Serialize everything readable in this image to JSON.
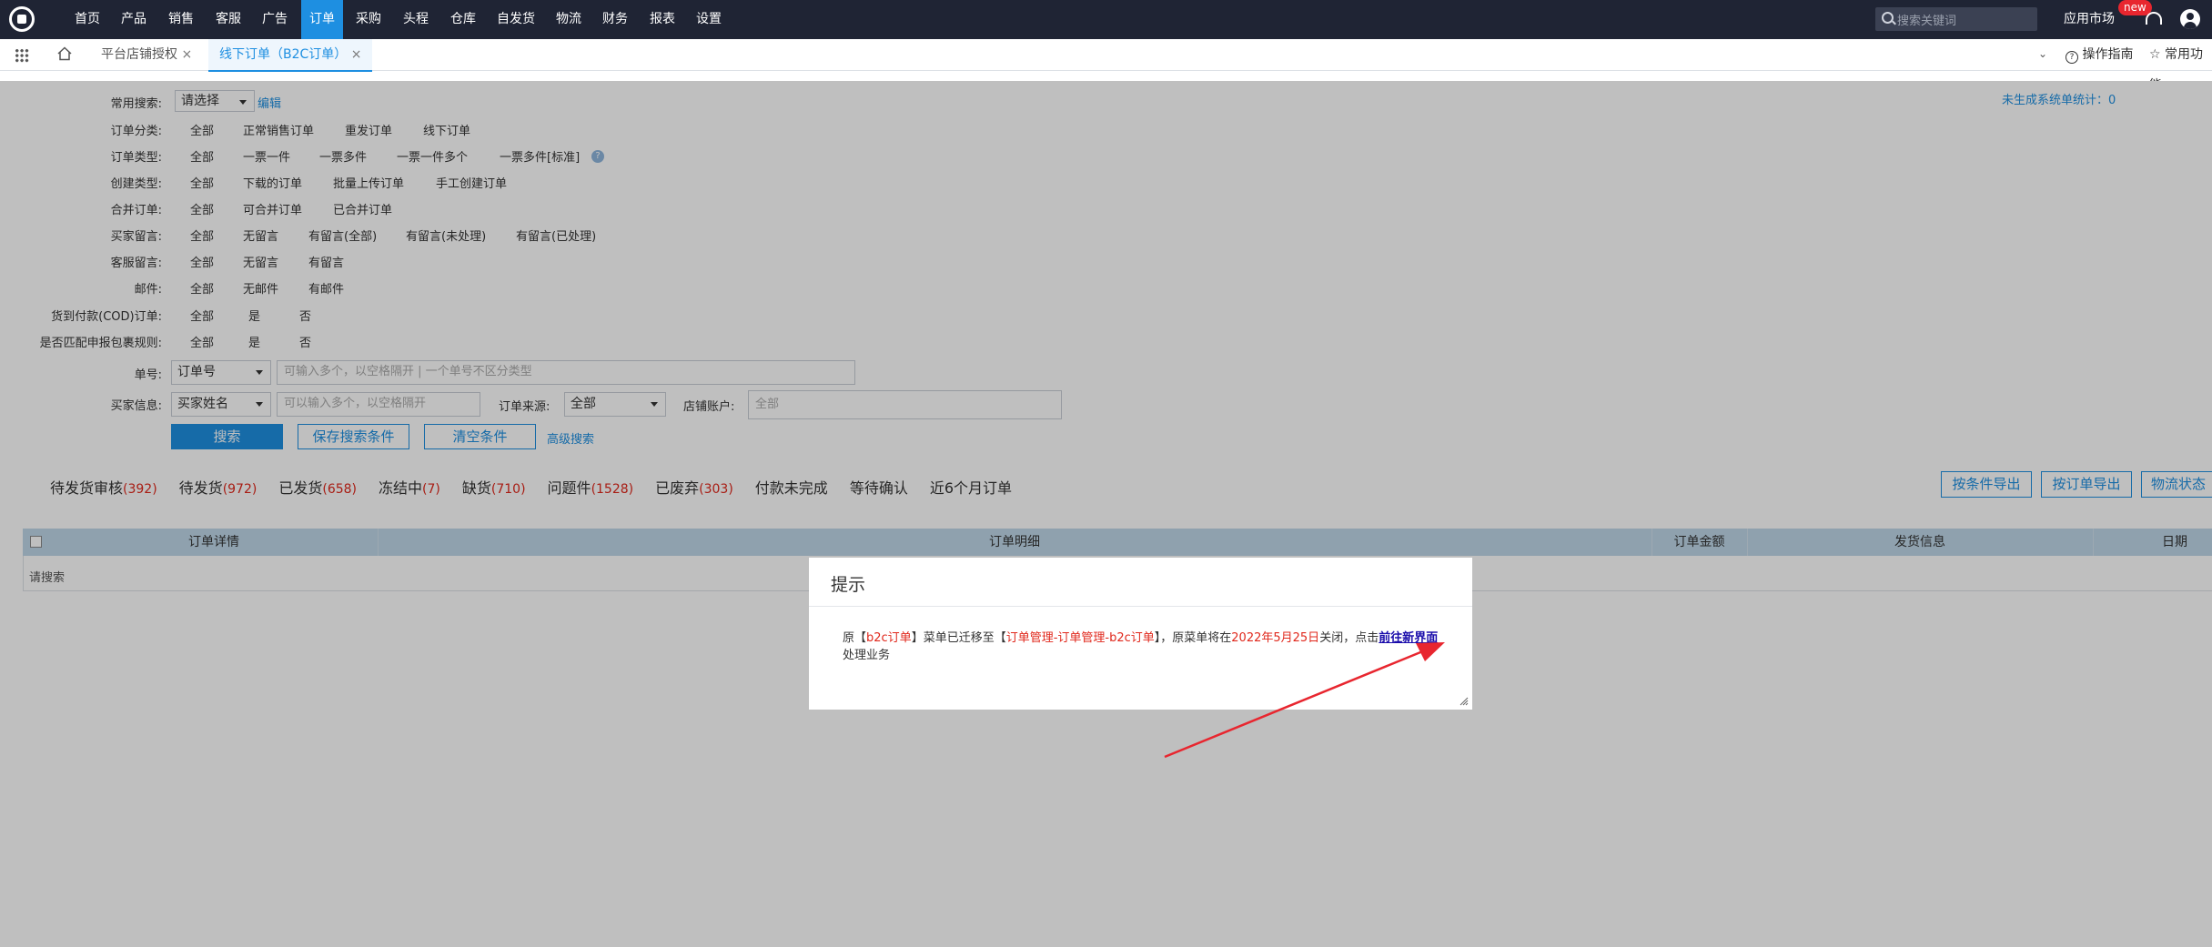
{
  "nav": {
    "items": [
      "首页",
      "产品",
      "销售",
      "客服",
      "广告",
      "订单",
      "采购",
      "头程",
      "仓库",
      "自发货",
      "物流",
      "财务",
      "报表",
      "设置"
    ],
    "active": "订单",
    "search_placeholder": "搜索关键词",
    "app_market": "应用市场",
    "new_badge": "new"
  },
  "tabs": {
    "items": [
      {
        "label": "平台店铺授权",
        "close": "×"
      },
      {
        "label": "线下订单（B2C订单）",
        "close": "×"
      }
    ],
    "guide": "操作指南",
    "common": "常用功能"
  },
  "filters": {
    "stats_link": "未生成系统单统计：0",
    "common_search_label": "常用搜索:",
    "common_search_value": "请选择",
    "edit": "编辑",
    "rows": [
      {
        "label": "订单分类:",
        "options": [
          "全部",
          "正常销售订单",
          "重发订单",
          "线下订单"
        ]
      },
      {
        "label": "订单类型:",
        "options": [
          "全部",
          "一票一件",
          "一票多件",
          "一票一件多个",
          "一票多件[标准]"
        ]
      },
      {
        "label": "创建类型:",
        "options": [
          "全部",
          "下载的订单",
          "批量上传订单",
          "手工创建订单"
        ]
      },
      {
        "label": "合并订单:",
        "options": [
          "全部",
          "可合并订单",
          "已合并订单"
        ]
      },
      {
        "label": "买家留言:",
        "options": [
          "全部",
          "无留言",
          "有留言(全部)",
          "有留言(未处理)",
          "有留言(已处理)"
        ]
      },
      {
        "label": "客服留言:",
        "options": [
          "全部",
          "无留言",
          "有留言"
        ]
      },
      {
        "label": "邮件:",
        "options": [
          "全部",
          "无邮件",
          "有邮件"
        ]
      },
      {
        "label": "货到付款(COD)订单:",
        "options": [
          "全部",
          "是",
          "否"
        ]
      },
      {
        "label": "是否匹配申报包裹规则:",
        "options": [
          "全部",
          "是",
          "否"
        ]
      }
    ],
    "help_glyph": "?",
    "order_no_label": "单号:",
    "order_no_type": "订单号",
    "order_no_placeholder": "可输入多个，以空格隔开 | 一个单号不区分类型",
    "buyer_label": "买家信息:",
    "buyer_type": "买家姓名",
    "buyer_placeholder": "可以输入多个，以空格隔开",
    "source_label": "订单来源:",
    "source_value": "全部",
    "account_label": "店铺账户:",
    "account_placeholder": "全部",
    "search_btn": "搜索",
    "save_btn": "保存搜索条件",
    "clear_btn": "清空条件",
    "advanced": "高级搜索"
  },
  "status_tabs": [
    {
      "label": "待发货审核",
      "count": "(392)"
    },
    {
      "label": "待发货",
      "count": "(972)"
    },
    {
      "label": "已发货",
      "count": "(658)"
    },
    {
      "label": "冻结中",
      "count": "(7)"
    },
    {
      "label": "缺货",
      "count": "(710)"
    },
    {
      "label": "问题件",
      "count": "(1528)"
    },
    {
      "label": "已废弃",
      "count": "(303)"
    },
    {
      "label": "付款未完成",
      "count": ""
    },
    {
      "label": "等待确认",
      "count": ""
    },
    {
      "label": "近6个月订单",
      "count": ""
    }
  ],
  "export_buttons": [
    "按条件导出",
    "按订单导出",
    "物流状态"
  ],
  "table": {
    "headers": [
      "订单详情",
      "订单明细",
      "订单金额",
      "发货信息",
      "日期"
    ],
    "empty_text": "请搜索"
  },
  "dialog": {
    "title": "提示",
    "p1": "原【",
    "p2": "b2c订单",
    "p3": "】菜单已迁移至【",
    "p4": "订单管理-订单管理-b2c订单",
    "p5": "】，原菜单将在",
    "p6": "2022年5月25日",
    "p7": "关闭，点击",
    "link": "前往新界面",
    "p8": "处理业务"
  },
  "colors": {
    "nav_bg": "#1f2434",
    "accent": "#1e8fe1",
    "count_red": "#e0271b",
    "arrow": "#e8262f"
  }
}
